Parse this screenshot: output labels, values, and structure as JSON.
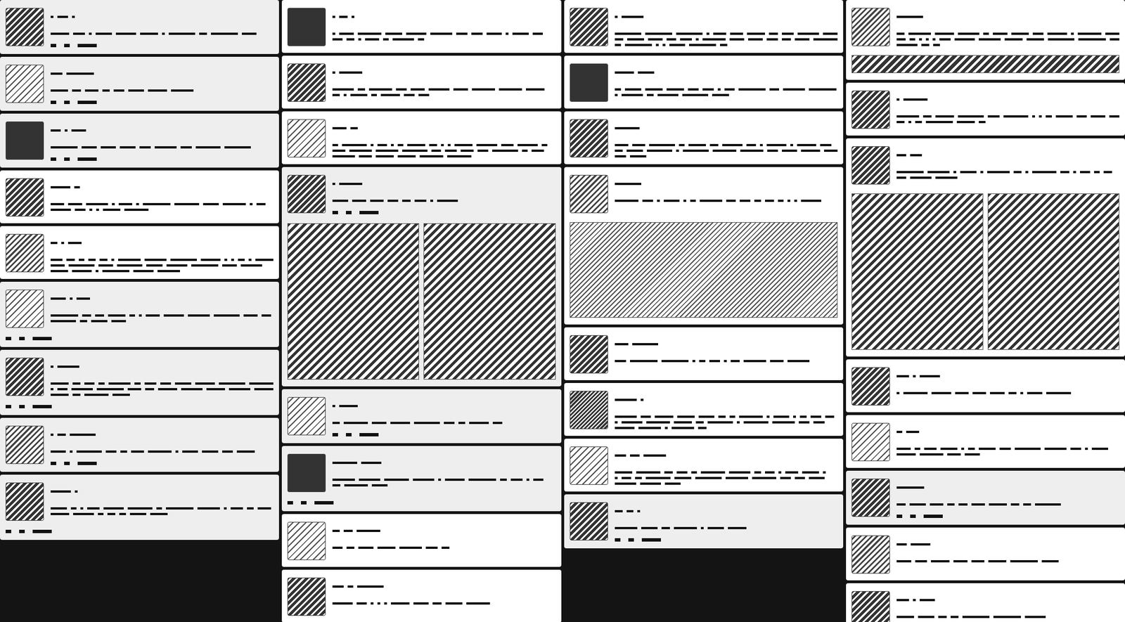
{
  "columns": [
    {
      "cards": [
        {
          "avatar": "dark",
          "shaded": true,
          "lines": 1,
          "footer": true,
          "media": "none"
        },
        {
          "avatar": "light",
          "shaded": true,
          "lines": 1,
          "footer": true,
          "media": "none"
        },
        {
          "avatar": "solid",
          "shaded": true,
          "lines": 1,
          "footer": true,
          "media": "none"
        },
        {
          "avatar": "dark",
          "shaded": false,
          "lines": 2,
          "footer": false,
          "media": "none"
        },
        {
          "avatar": "medium",
          "shaded": false,
          "lines": 3,
          "footer": false,
          "media": "none"
        },
        {
          "avatar": "light",
          "shaded": true,
          "lines": 2,
          "footer": true,
          "media": "none"
        },
        {
          "avatar": "dark",
          "shaded": true,
          "lines": 3,
          "footer": true,
          "media": "none"
        },
        {
          "avatar": "medium",
          "shaded": true,
          "lines": 1,
          "footer": true,
          "media": "none"
        },
        {
          "avatar": "dark",
          "shaded": true,
          "lines": 2,
          "footer": true,
          "media": "none"
        }
      ]
    },
    {
      "cards": [
        {
          "avatar": "solid",
          "shaded": false,
          "lines": 2,
          "footer": false,
          "media": "none"
        },
        {
          "avatar": "dark",
          "shaded": false,
          "lines": 2,
          "footer": false,
          "media": "none"
        },
        {
          "avatar": "light",
          "shaded": false,
          "lines": 3,
          "footer": false,
          "media": "none"
        },
        {
          "avatar": "dark",
          "shaded": true,
          "lines": 1,
          "footer": true,
          "media": "two"
        },
        {
          "avatar": "light",
          "shaded": true,
          "lines": 1,
          "footer": true,
          "media": "none"
        },
        {
          "avatar": "solid",
          "shaded": true,
          "lines": 2,
          "footer": true,
          "media": "none"
        },
        {
          "avatar": "light",
          "shaded": false,
          "lines": 1,
          "footer": false,
          "media": "none"
        },
        {
          "avatar": "dark",
          "shaded": false,
          "lines": 1,
          "footer": false,
          "media": "none"
        }
      ]
    },
    {
      "cards": [
        {
          "avatar": "dark",
          "shaded": false,
          "lines": 3,
          "footer": false,
          "media": "none"
        },
        {
          "avatar": "solid",
          "shaded": false,
          "lines": 2,
          "footer": false,
          "media": "none"
        },
        {
          "avatar": "dark",
          "shaded": false,
          "lines": 3,
          "footer": false,
          "media": "none"
        },
        {
          "avatar": "medium",
          "shaded": false,
          "lines": 1,
          "footer": false,
          "media": "one"
        },
        {
          "avatar": "dark",
          "shaded": false,
          "lines": 1,
          "footer": false,
          "media": "none"
        },
        {
          "avatar": "dense",
          "shaded": false,
          "lines": 3,
          "footer": false,
          "media": "none"
        },
        {
          "avatar": "light",
          "shaded": false,
          "lines": 3,
          "footer": false,
          "media": "none"
        },
        {
          "avatar": "dark",
          "shaded": true,
          "lines": 1,
          "footer": true,
          "media": "none"
        }
      ]
    },
    {
      "cards": [
        {
          "avatar": "medium",
          "shaded": false,
          "lines": 3,
          "footer": false,
          "media": "banner"
        },
        {
          "avatar": "dark",
          "shaded": false,
          "lines": 2,
          "footer": false,
          "media": "none"
        },
        {
          "avatar": "dark",
          "shaded": false,
          "lines": 2,
          "footer": false,
          "media": "two"
        },
        {
          "avatar": "dark",
          "shaded": false,
          "lines": 1,
          "footer": false,
          "media": "none"
        },
        {
          "avatar": "light",
          "shaded": false,
          "lines": 2,
          "footer": false,
          "media": "none"
        },
        {
          "avatar": "dark",
          "shaded": true,
          "lines": 1,
          "footer": true,
          "media": "none"
        },
        {
          "avatar": "medium",
          "shaded": false,
          "lines": 1,
          "footer": false,
          "media": "none"
        },
        {
          "avatar": "dark",
          "shaded": false,
          "lines": 1,
          "footer": false,
          "media": "none"
        }
      ]
    }
  ]
}
